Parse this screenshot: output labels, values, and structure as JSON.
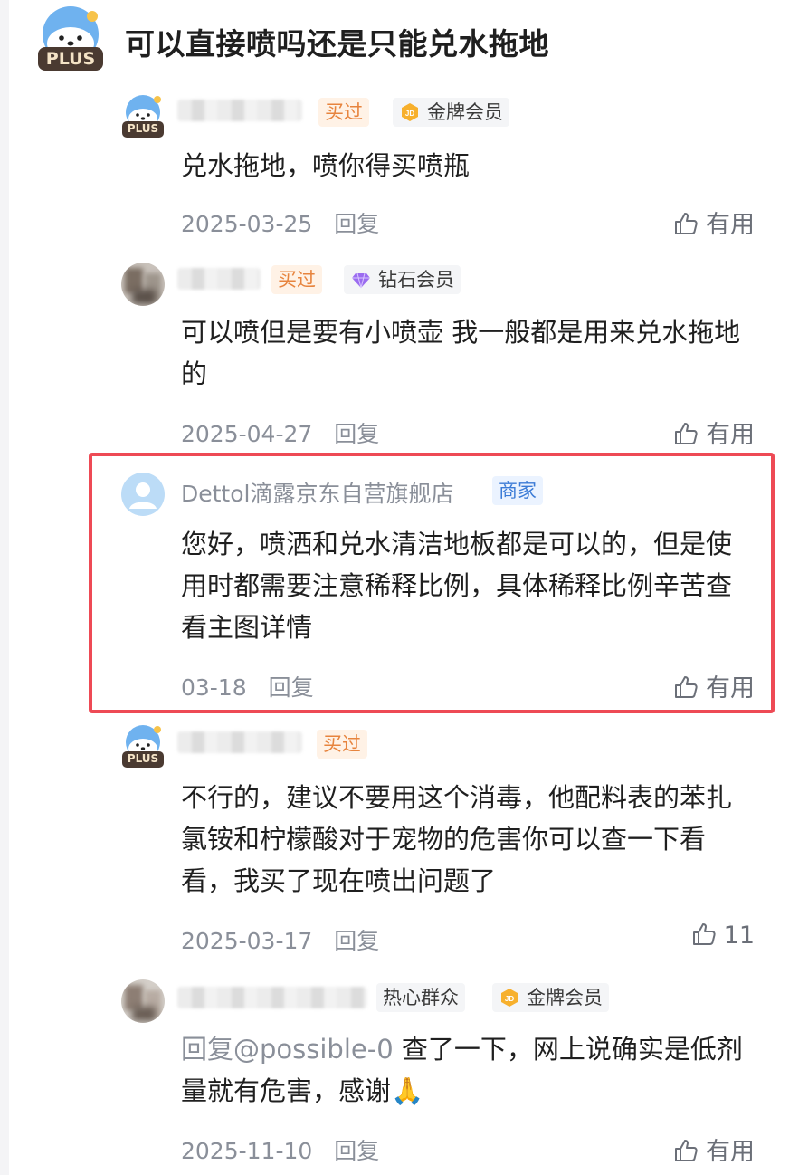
{
  "question": {
    "avatar_badge": "PLUS",
    "title": "可以直接喷吗还是只能兑水拖地"
  },
  "comments": [
    {
      "avatar_badge": "PLUS",
      "tags": [
        "买过",
        "金牌会员"
      ],
      "text": "兑水拖地，喷你得买喷瓶",
      "date": "2025-03-25",
      "reply_label": "回复",
      "like_label": "有用"
    },
    {
      "tags": [
        "买过",
        "钻石会员"
      ],
      "text": "可以喷但是要有小喷壶 我一般都是用来兑水拖地的",
      "date": "2025-04-27",
      "reply_label": "回复",
      "like_label": "有用"
    },
    {
      "name": "Dettol滴露京东自营旗舰店",
      "tags": [
        "商家"
      ],
      "text": "您好，喷洒和兑水清洁地板都是可以的，但是使用时都需要注意稀释比例，具体稀释比例辛苦查看主图详情",
      "date": "03-18",
      "reply_label": "回复",
      "like_label": "有用"
    },
    {
      "avatar_badge": "PLUS",
      "tags": [
        "买过"
      ],
      "text": "不行的，建议不要用这个消毒，他配料表的苯扎氯铵和柠檬酸对于宠物的危害你可以查一下看看，我买了现在喷出问题了",
      "date": "2025-03-17",
      "reply_label": "回复",
      "like_label": "11"
    },
    {
      "tags": [
        "热心群众",
        "金牌会员"
      ],
      "reply_to": "回复@possible-0",
      "text": "查了一下，网上说确实是低剂量就有危害，感谢🙏",
      "date": "2025-11-10",
      "reply_label": "回复",
      "like_label": "有用"
    }
  ],
  "colors": {
    "highlight_border": "#ee4a55",
    "bought_tag": "#e7843e",
    "merchant_tag": "#3b7bd6",
    "meta_gray": "#8a8f99"
  },
  "icons": {
    "like": "thumbs-up-icon",
    "gold_member": "jd-gold-badge-icon",
    "diamond_member": "diamond-icon",
    "plus_avatar": "plus-polar-bear-avatar"
  }
}
